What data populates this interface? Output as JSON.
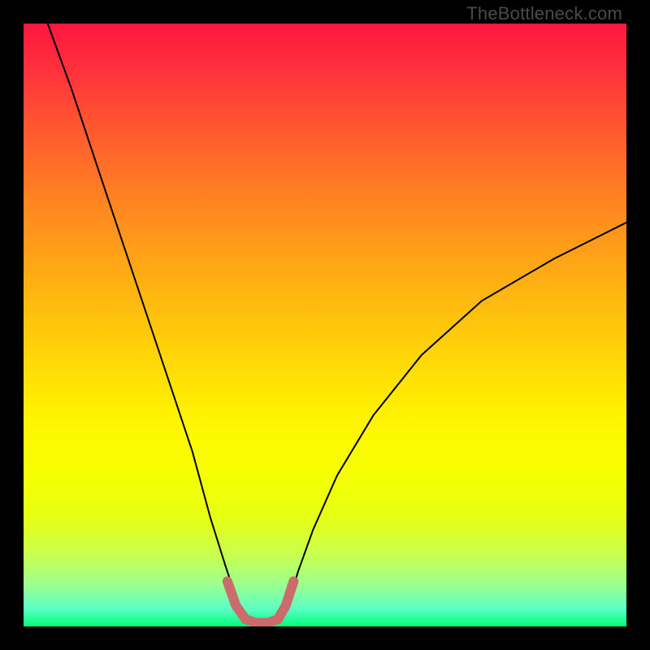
{
  "watermark": "TheBottleneck.com",
  "chart_data": {
    "type": "line",
    "title": "",
    "xlabel": "",
    "ylabel": "",
    "xlim": [
      0,
      100
    ],
    "ylim": [
      0,
      100
    ],
    "grid": false,
    "series": [
      {
        "name": "bottleneck-curve",
        "x": [
          4,
          8,
          12,
          16,
          20,
          24,
          28,
          31,
          33.5,
          35.5,
          37.5,
          40,
          42.5,
          44,
          45.5,
          48,
          52,
          58,
          66,
          76,
          88,
          100
        ],
        "y": [
          100,
          89,
          77,
          65,
          53,
          41,
          29,
          18,
          10,
          4,
          1,
          0,
          1,
          4,
          9,
          16,
          25,
          35,
          45,
          54,
          61,
          67
        ],
        "color": "#000000",
        "weight": 2
      },
      {
        "name": "optimal-zone-marker",
        "x": [
          33.8,
          35.2,
          36.8,
          38.5,
          40.5,
          42.2,
          43.5,
          44.8
        ],
        "y": [
          7.5,
          3.5,
          1.2,
          0.6,
          0.6,
          1.2,
          3.5,
          7.5
        ],
        "color": "#cc6b6b",
        "weight": 12
      }
    ],
    "background_gradient": {
      "stops": [
        {
          "pos": 0.0,
          "color": "#ff163f"
        },
        {
          "pos": 0.66,
          "color": "#fff500"
        },
        {
          "pos": 1.0,
          "color": "#00ff7b"
        }
      ]
    }
  }
}
